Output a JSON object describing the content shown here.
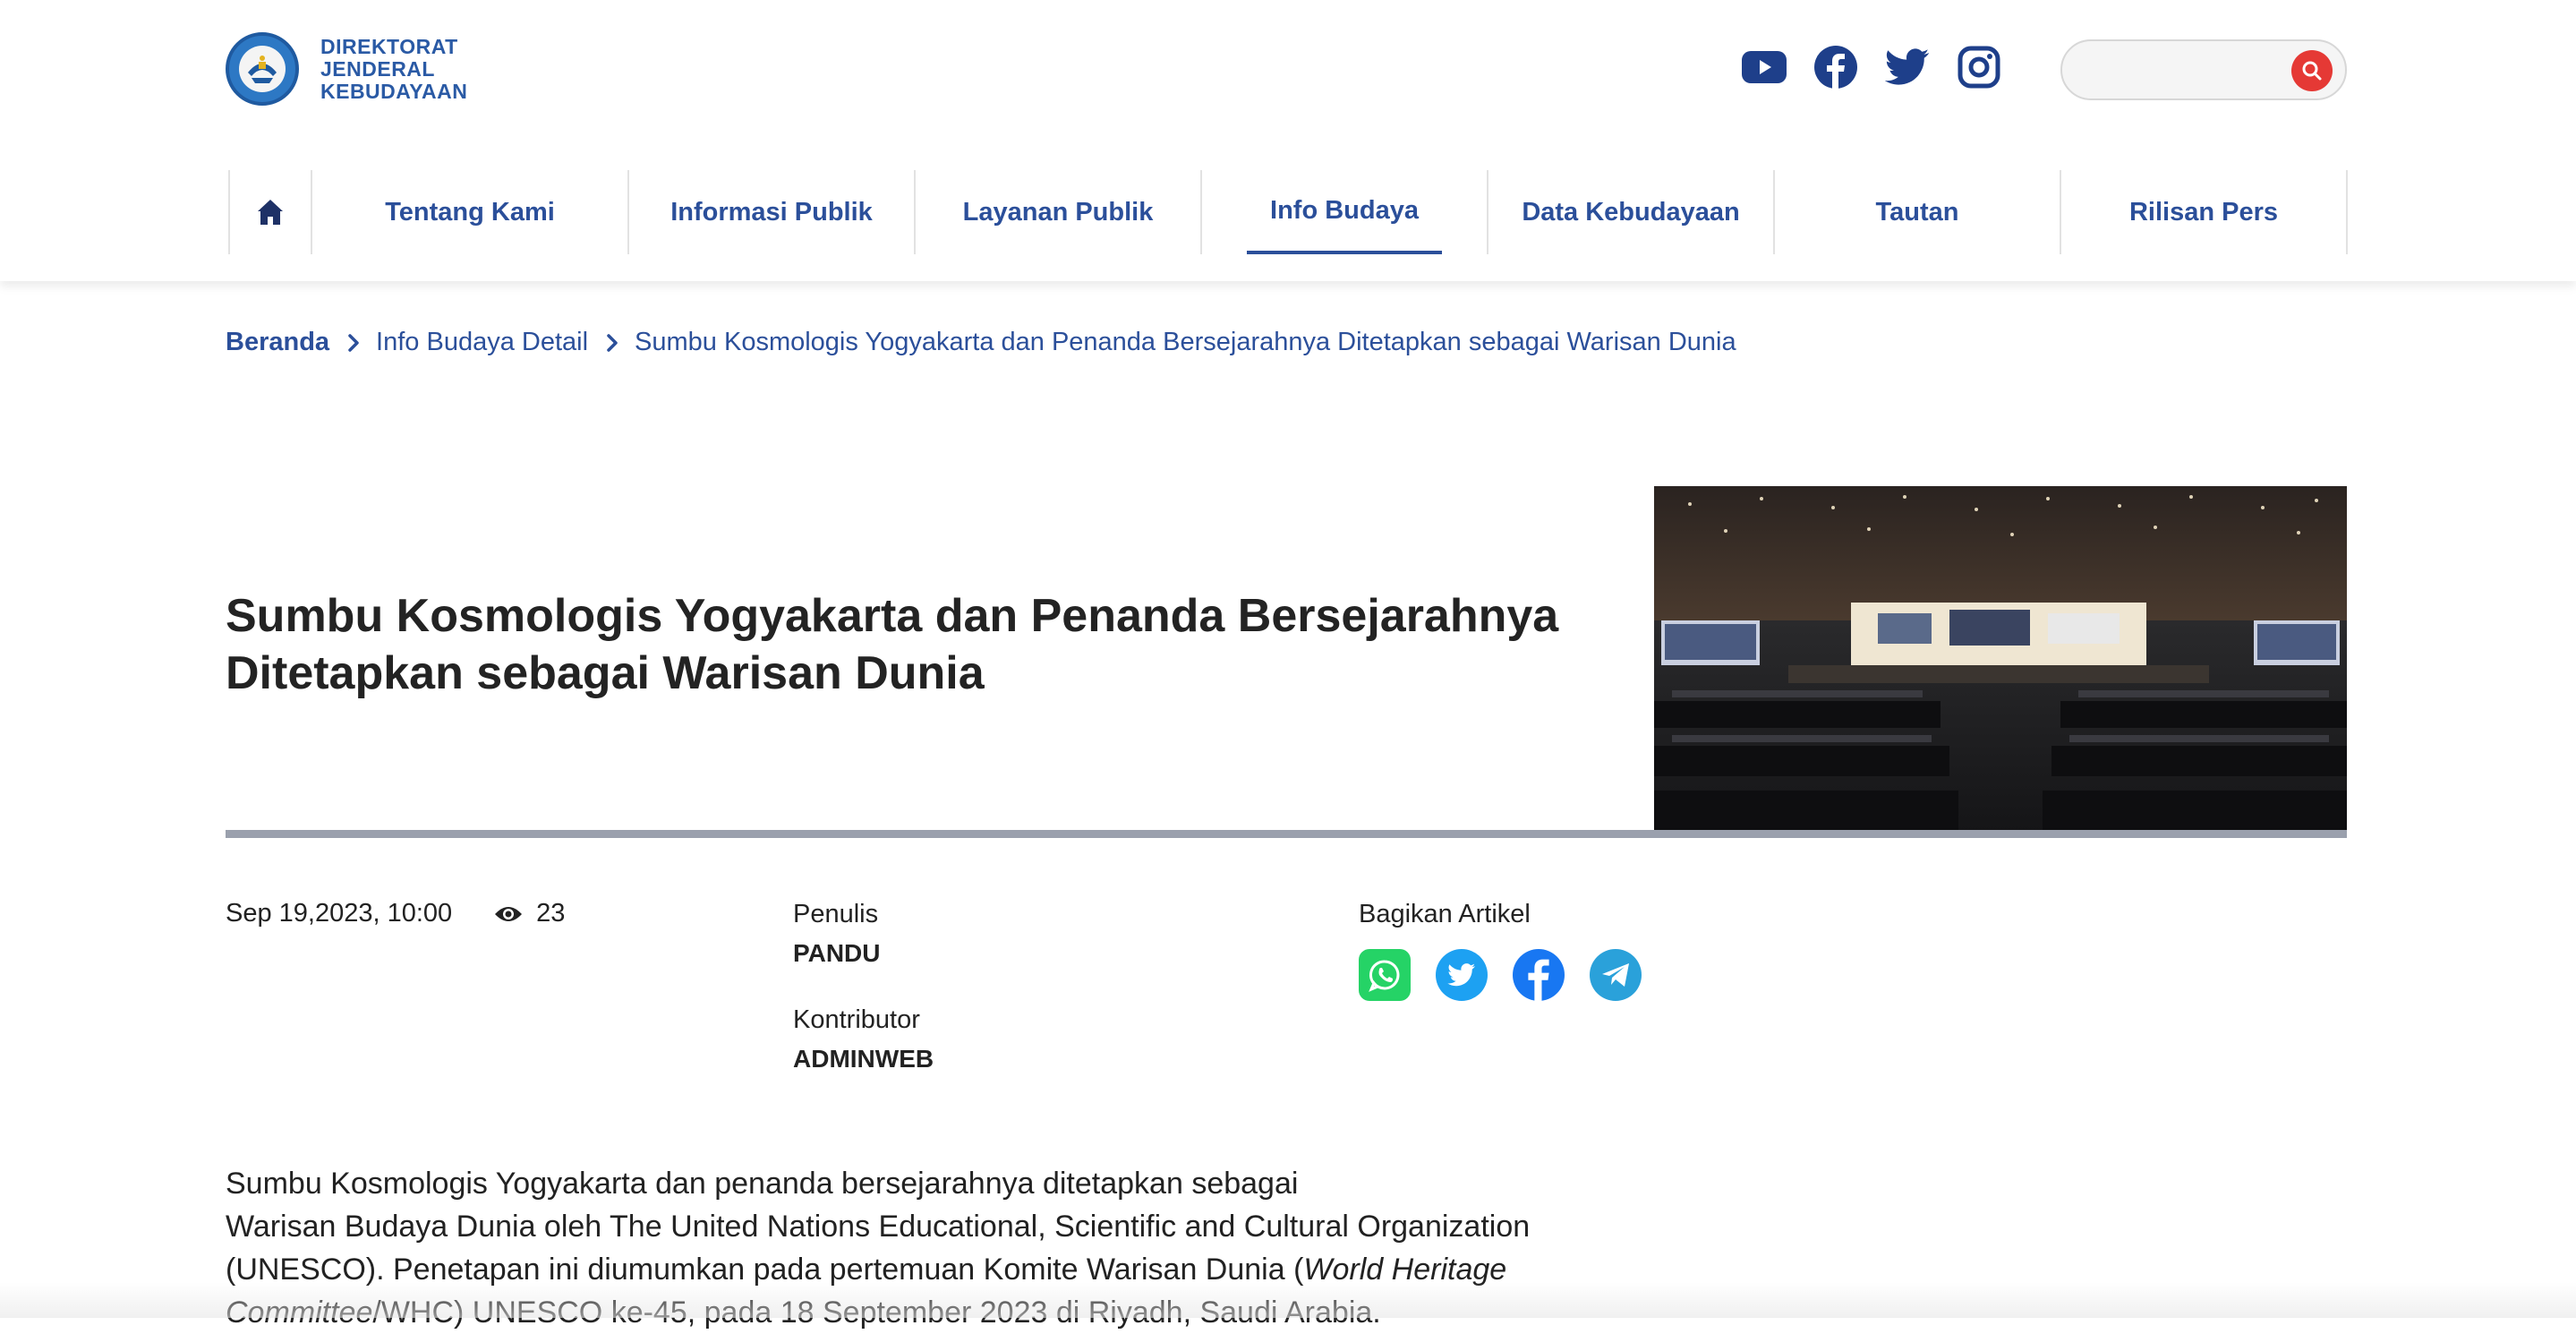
{
  "logo": {
    "line1": "DIREKTORAT",
    "line2": "JENDERAL",
    "line3": "KEBUDAYAAN"
  },
  "socials": [
    "youtube-icon",
    "facebook-icon",
    "twitter-icon",
    "instagram-icon"
  ],
  "search": {
    "placeholder": "",
    "value": ""
  },
  "nav": {
    "items": [
      {
        "label": "Tentang Kami"
      },
      {
        "label": "Informasi Publik"
      },
      {
        "label": "Layanan Publik"
      },
      {
        "label": "Info Budaya",
        "active": true
      },
      {
        "label": "Data Kebudayaan"
      },
      {
        "label": "Tautan"
      },
      {
        "label": "Rilisan Pers"
      }
    ]
  },
  "breadcrumb": {
    "home": "Beranda",
    "level1": "Info Budaya Detail",
    "current": "Sumbu Kosmologis Yogyakarta dan Penanda Bersejarahnya Ditetapkan sebagai Warisan Dunia"
  },
  "article": {
    "title_line1": "Sumbu Kosmologis Yogyakarta dan Penanda Bersejarahnya",
    "title_line2": "Ditetapkan sebagai Warisan Dunia",
    "date": "Sep 19,2023, 10:00",
    "views": "23",
    "writer_label": "Penulis",
    "writer": "PANDU",
    "contributor_label": "Kontributor",
    "contributor": "ADMINWEB",
    "share_label": "Bagikan Artikel",
    "body": {
      "line1": "Sumbu Kosmologis Yogyakarta dan penanda bersejarahnya ditetapkan sebagai",
      "line2": "Warisan Budaya Dunia oleh The United Nations Educational, Scientific and Cultural Organization",
      "line3_a": "(UNESCO). Penetapan ini diumumkan pada pertemuan Komite Warisan Dunia (",
      "line3_b": "World Heritage",
      "line4_a": "Committee",
      "line4_b": "/WHC) UNESCO ke-45, pada 18 September 2023 di Riyadh, Saudi Arabia."
    }
  },
  "colors": {
    "brand": "#2b4f9a",
    "search_button": "#e53935",
    "divider": "#9aa0ad",
    "whatsapp": "#25d366",
    "twitter": "#1da1f2",
    "facebook": "#1877f2",
    "telegram": "#2aa1da"
  }
}
